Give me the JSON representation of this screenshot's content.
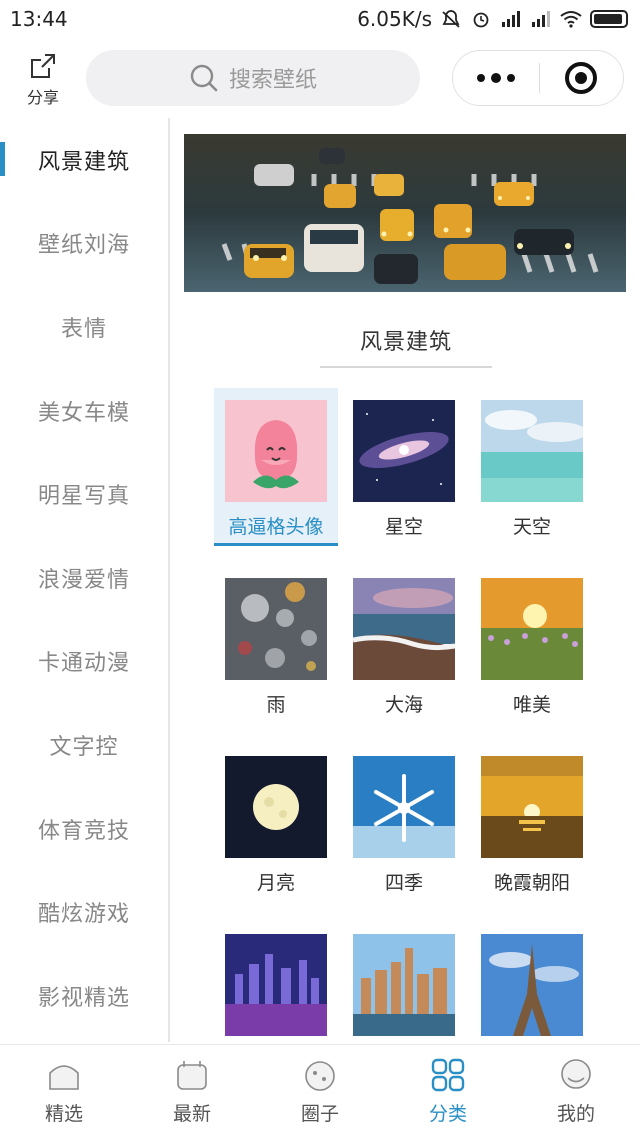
{
  "status_bar": {
    "time": "13:44",
    "speed": "6.05K/s"
  },
  "top": {
    "share_label": "分享",
    "search_placeholder": "搜索壁纸"
  },
  "sidebar": {
    "items": [
      {
        "label": "风景建筑",
        "active": true
      },
      {
        "label": "壁纸刘海",
        "active": false
      },
      {
        "label": "表情",
        "active": false
      },
      {
        "label": "美女车模",
        "active": false
      },
      {
        "label": "明星写真",
        "active": false
      },
      {
        "label": "浪漫爱情",
        "active": false
      },
      {
        "label": "卡通动漫",
        "active": false
      },
      {
        "label": "文字控",
        "active": false
      },
      {
        "label": "体育竞技",
        "active": false
      },
      {
        "label": "酷炫游戏",
        "active": false
      },
      {
        "label": "影视精选",
        "active": false
      }
    ]
  },
  "main": {
    "section_title": "风景建筑",
    "grid": [
      {
        "label": "高逼格头像",
        "selected": true
      },
      {
        "label": "星空",
        "selected": false
      },
      {
        "label": "天空",
        "selected": false
      },
      {
        "label": "雨",
        "selected": false
      },
      {
        "label": "大海",
        "selected": false
      },
      {
        "label": "唯美",
        "selected": false
      },
      {
        "label": "月亮",
        "selected": false
      },
      {
        "label": "四季",
        "selected": false
      },
      {
        "label": "晚霞朝阳",
        "selected": false
      },
      {
        "label": "",
        "selected": false
      },
      {
        "label": "",
        "selected": false
      },
      {
        "label": "",
        "selected": false
      }
    ]
  },
  "bottom_nav": {
    "items": [
      {
        "label": "精选",
        "active": false
      },
      {
        "label": "最新",
        "active": false
      },
      {
        "label": "圈子",
        "active": false
      },
      {
        "label": "分类",
        "active": true
      },
      {
        "label": "我的",
        "active": false
      }
    ]
  },
  "colors": {
    "accent": "#2a8fc7",
    "sidebar_inactive": "#888888",
    "search_bg": "#f0f0f2"
  }
}
